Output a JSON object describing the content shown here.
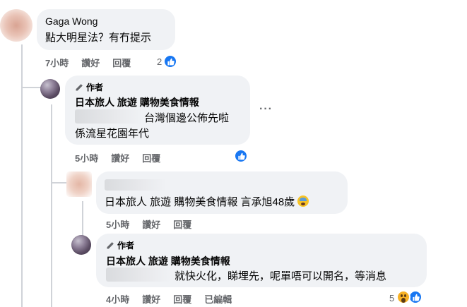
{
  "comment1": {
    "name": "Gaga Wong",
    "text": "點大明星法？有冇提示",
    "time": "7小時",
    "like": "讚好",
    "reply": "回覆",
    "reaction_count": "2",
    "reaction_icon": "like-icon"
  },
  "reply1": {
    "author_badge": "作者",
    "name": "日本旅人 旅遊 購物美食情報",
    "text_line1": "台灣個邊公佈先啦",
    "text_line2": "係流星花園年代",
    "time": "5小時",
    "like": "讚好",
    "reply": "回覆",
    "reaction_icon": "like-icon",
    "more": "···"
  },
  "reply2": {
    "text": "日本旅人 旅遊 購物美食情報 言承旭48歲",
    "time": "5小時",
    "like": "讚好",
    "reply": "回覆",
    "emoji_icon": "fearful-face-icon"
  },
  "reply3": {
    "author_badge": "作者",
    "name": "日本旅人 旅遊 購物美食情報",
    "text": "就快火化，睇埋先，呢單唔可以開名，等消息",
    "time": "4小時",
    "like": "讚好",
    "reply": "回覆",
    "edited": "已編輯",
    "reaction_count": "5",
    "reaction_icons": [
      "wow-icon",
      "like-icon"
    ]
  },
  "colors": {
    "bubble": "#f0f2f5",
    "meta": "#65676b",
    "like_blue": "#1877f2",
    "thread_line": "#d0d3d8"
  }
}
